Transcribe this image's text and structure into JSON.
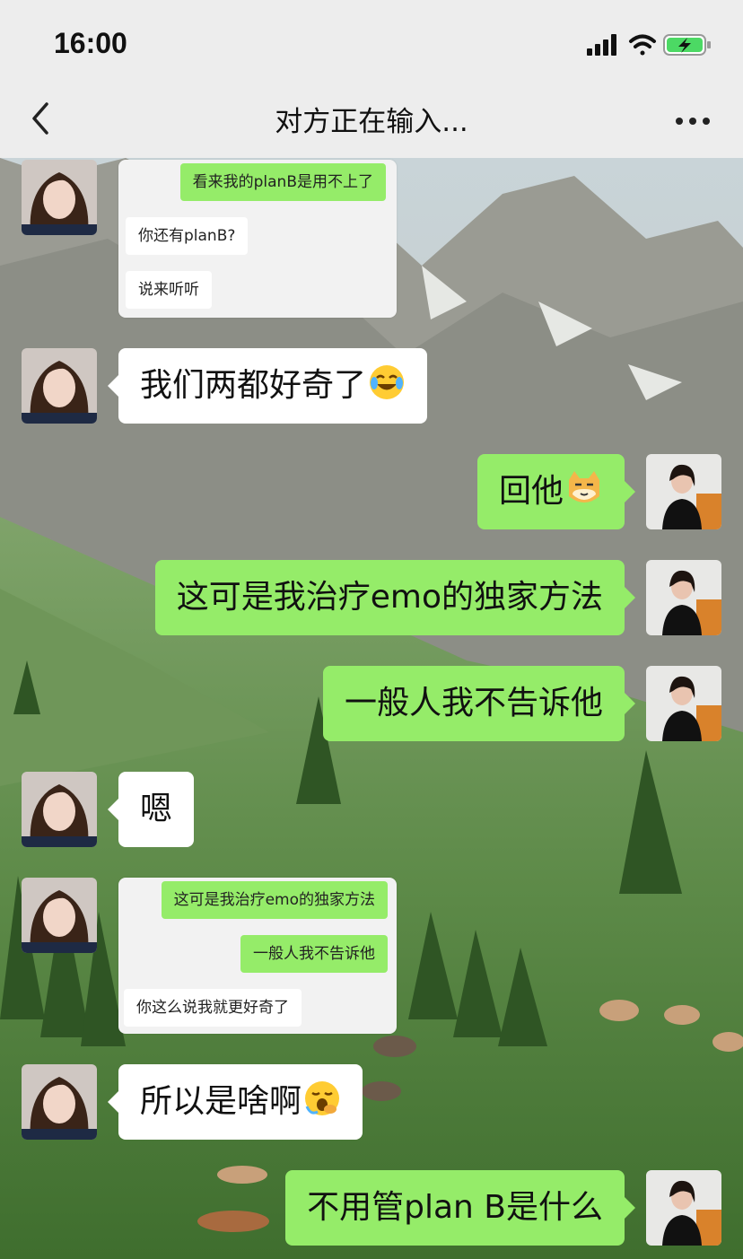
{
  "status": {
    "time": "16:00"
  },
  "header": {
    "title": "对方正在输入..."
  },
  "messages": {
    "shot1": {
      "m1": "看来我的planB是用不上了",
      "m2": "你还有planB?",
      "m3": "说来听听"
    },
    "msg1": "我们两都好奇了",
    "msg2": "回他",
    "msg3": "这可是我治疗emo的独家方法",
    "msg4": "一般人我不告诉他",
    "msg5": "嗯",
    "shot2": {
      "m1": "这可是我治疗emo的独家方法",
      "m2": "一般人我不告诉他",
      "m3": "你这么说我就更好奇了"
    },
    "msg6": "所以是啥啊",
    "msg7": "不用管plan B是什么"
  },
  "icons": {
    "emoji1": "laughing-tears-emoji",
    "emoji2": "doge-cat-emoji",
    "emoji3": "yawning-emoji"
  },
  "colors": {
    "sent_bubble": "#95ec69",
    "received_bubble": "#ffffff",
    "bar": "#ededed"
  }
}
